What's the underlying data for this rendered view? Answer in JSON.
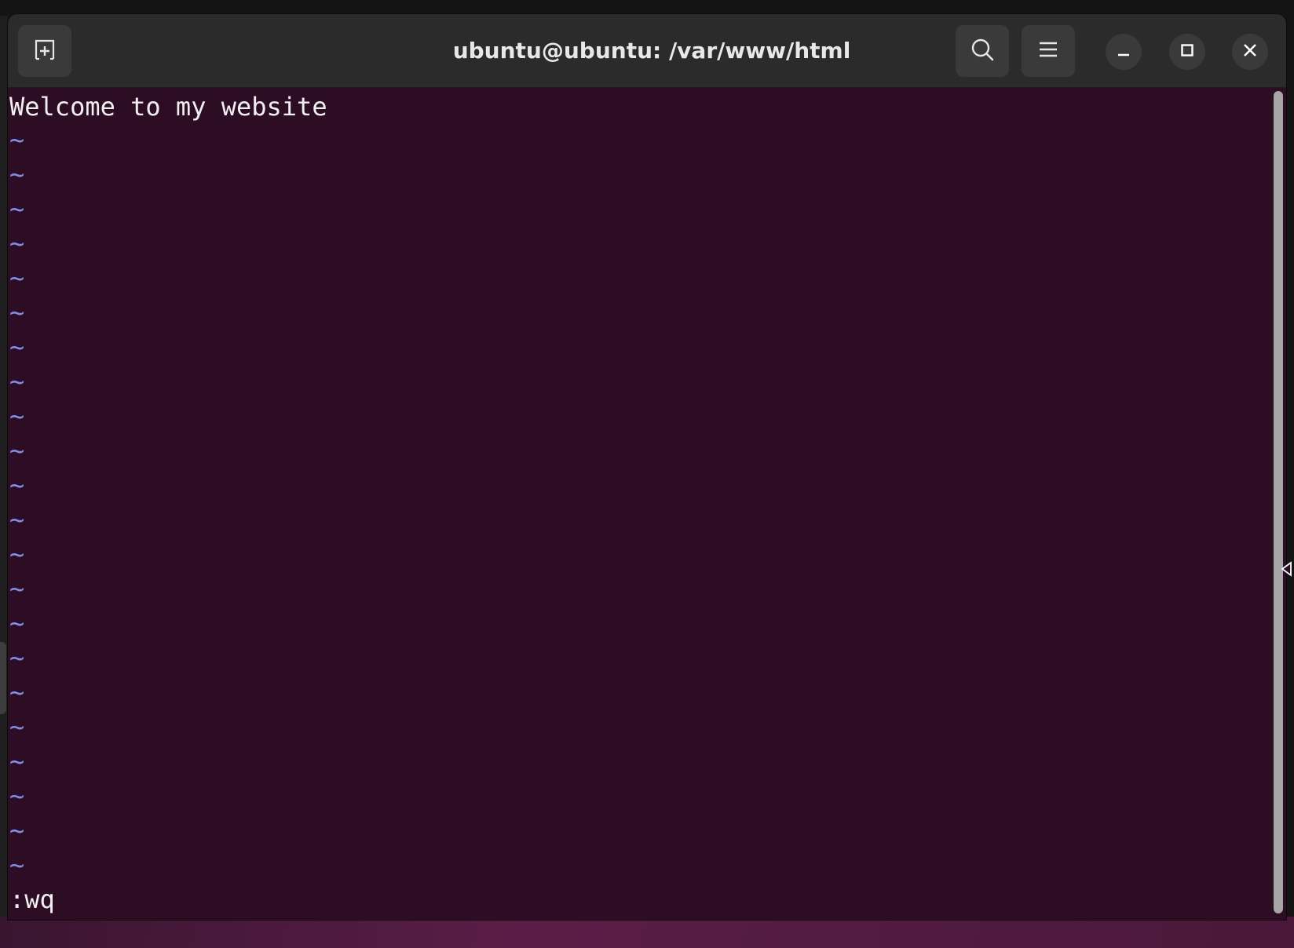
{
  "window": {
    "title": "ubuntu@ubuntu: /var/www/html"
  },
  "titlebar": {
    "new_tab_icon": "new-tab-icon",
    "search_icon": "search-icon",
    "menu_icon": "hamburger-menu-icon",
    "minimize_icon": "minimize-icon",
    "maximize_icon": "maximize-icon",
    "close_icon": "close-icon"
  },
  "editor": {
    "content_line": "Welcome to my website",
    "empty_line_marker": "~",
    "command_line": ":wq"
  },
  "colors": {
    "terminal_bg": "#2c0d24",
    "titlebar_bg": "#2b2b2b",
    "tilde_color": "#7d8fe6",
    "text_color": "#f0f0f0"
  }
}
